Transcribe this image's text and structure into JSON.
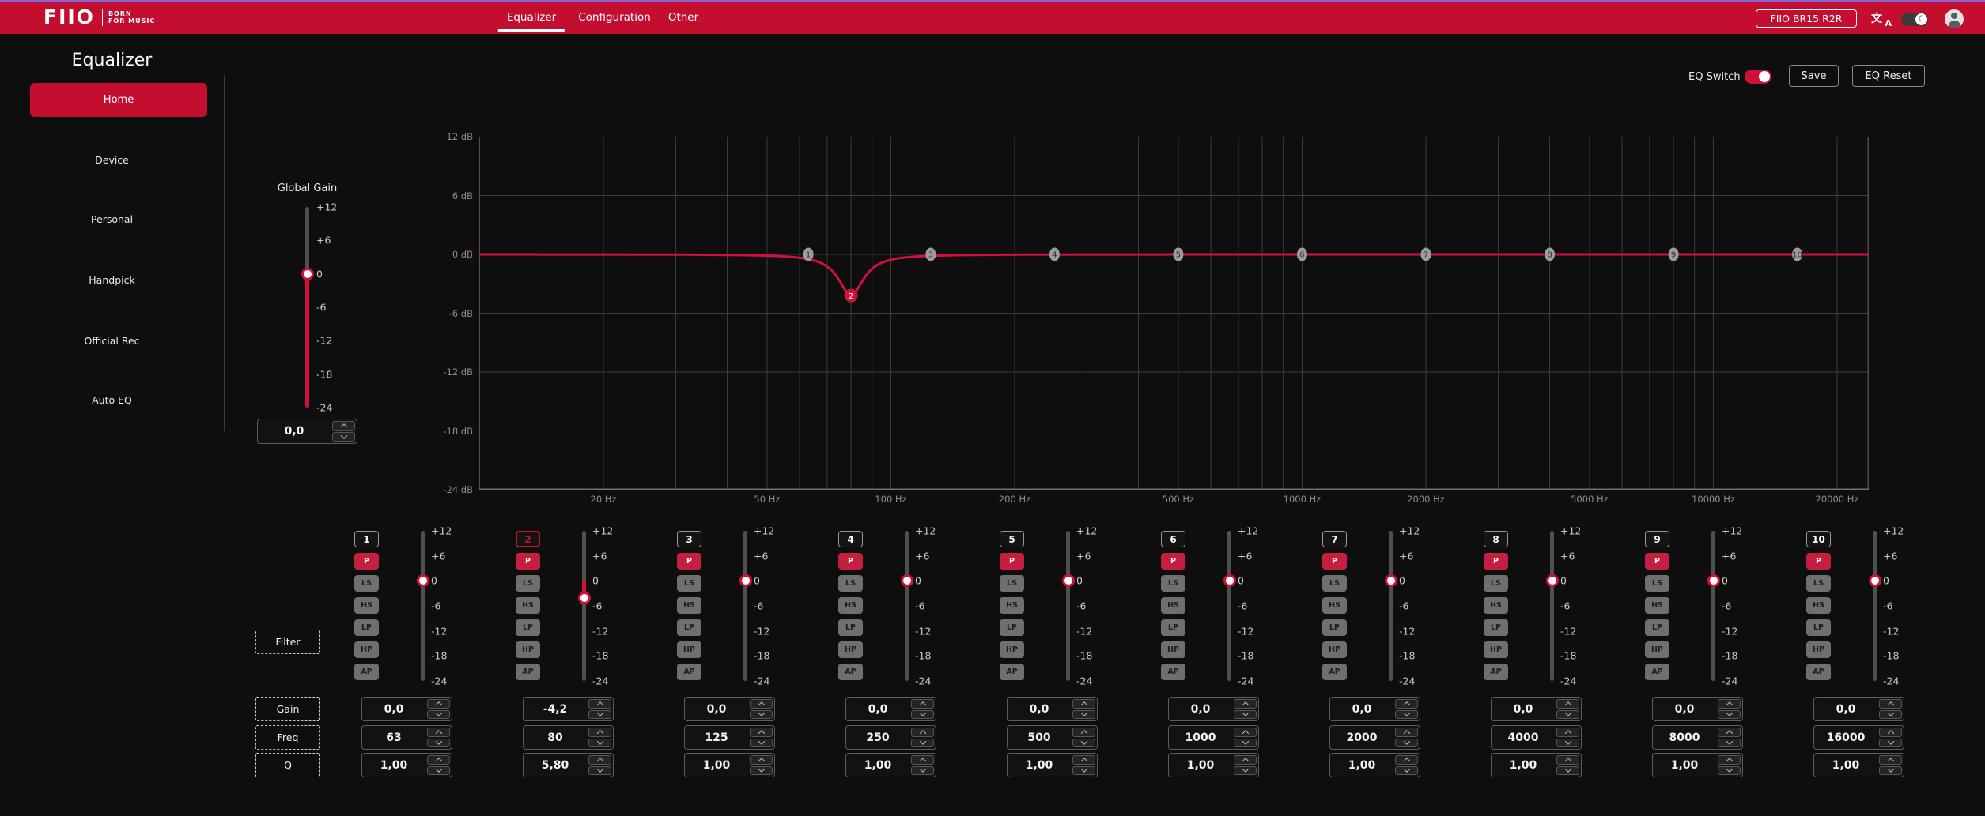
{
  "header": {
    "logo": {
      "brand": "FIIO",
      "tagline1": "BORN",
      "tagline2": "FOR MUSIC"
    },
    "tabs": [
      {
        "label": "Equalizer",
        "active": true
      },
      {
        "label": "Configuration",
        "active": false
      },
      {
        "label": "Other",
        "active": false
      }
    ],
    "device_button": "FIIO BR15 R2R",
    "icons": {
      "translate_zh": "文",
      "translate_a": "A",
      "dark_mode_knob": "☾"
    }
  },
  "sidebar": {
    "title": "Equalizer",
    "items": [
      {
        "label": "Home",
        "active": true
      },
      {
        "label": "Device",
        "active": false
      },
      {
        "label": "Personal",
        "active": false
      },
      {
        "label": "Handpick",
        "active": false
      },
      {
        "label": "Official Rec",
        "active": false
      },
      {
        "label": "Auto EQ",
        "active": false
      }
    ]
  },
  "toolbar": {
    "eq_switch_label": "EQ Switch",
    "eq_switch_on": true,
    "save_label": "Save",
    "reset_label": "EQ Reset"
  },
  "global_gain": {
    "label": "Global Gain",
    "value": "0,0",
    "value_db": 0,
    "scale": [
      "+12",
      "+6",
      "0",
      "-6",
      "-12",
      "-18",
      "-24"
    ]
  },
  "row_labels": {
    "filter": "Filter",
    "gain": "Gain",
    "freq": "Freq",
    "q": "Q"
  },
  "filter_types": [
    "P",
    "LS",
    "HS",
    "LP",
    "HP",
    "AP"
  ],
  "slider_scale": [
    "+12",
    "+6",
    "0",
    "-6",
    "-12",
    "-18",
    "-24"
  ],
  "chart_data": {
    "type": "line",
    "title": "EQ frequency response",
    "x_axis": {
      "scale": "log",
      "unit": "Hz",
      "range_hz": [
        10,
        24000
      ],
      "tick_freqs": [
        20,
        50,
        100,
        200,
        500,
        1000,
        2000,
        5000,
        10000,
        20000
      ],
      "tick_labels": [
        "20 Hz",
        "50 Hz",
        "100 Hz",
        "200 Hz",
        "500 Hz",
        "1000 Hz",
        "2000 Hz",
        "5000 Hz",
        "10000 Hz",
        "20000 Hz"
      ],
      "grid_freqs": [
        10,
        20,
        30,
        40,
        50,
        60,
        70,
        80,
        90,
        100,
        200,
        300,
        400,
        500,
        600,
        700,
        800,
        900,
        1000,
        2000,
        3000,
        4000,
        5000,
        6000,
        7000,
        8000,
        9000,
        10000,
        20000
      ]
    },
    "y_axis": {
      "unit": "dB",
      "range_db": [
        -24,
        12
      ],
      "tick_values": [
        12,
        6,
        0,
        -6,
        -12,
        -18,
        -24
      ],
      "tick_labels": [
        "12 dB",
        "6 dB",
        "0 dB",
        "-6 dB",
        "-12 dB",
        "-18 dB",
        "-24 dB"
      ]
    },
    "grid": true,
    "curve_color": "#d50f3c",
    "curve_description": "flat at 0 dB with a narrow notch of -4.2 dB at 80 Hz (Q 5.8)",
    "bands": [
      {
        "number": "1",
        "filter": "P",
        "freq": 63,
        "gain": 0,
        "q": 1.0,
        "selected": false,
        "gain_text": "0,0",
        "freq_text": "63",
        "q_text": "1,00"
      },
      {
        "number": "2",
        "filter": "P",
        "freq": 80,
        "gain": -4.2,
        "q": 5.8,
        "selected": true,
        "gain_text": "-4,2",
        "freq_text": "80",
        "q_text": "5,80"
      },
      {
        "number": "3",
        "filter": "P",
        "freq": 125,
        "gain": 0,
        "q": 1.0,
        "selected": false,
        "gain_text": "0,0",
        "freq_text": "125",
        "q_text": "1,00"
      },
      {
        "number": "4",
        "filter": "P",
        "freq": 250,
        "gain": 0,
        "q": 1.0,
        "selected": false,
        "gain_text": "0,0",
        "freq_text": "250",
        "q_text": "1,00"
      },
      {
        "number": "5",
        "filter": "P",
        "freq": 500,
        "gain": 0,
        "q": 1.0,
        "selected": false,
        "gain_text": "0,0",
        "freq_text": "500",
        "q_text": "1,00"
      },
      {
        "number": "6",
        "filter": "P",
        "freq": 1000,
        "gain": 0,
        "q": 1.0,
        "selected": false,
        "gain_text": "0,0",
        "freq_text": "1000",
        "q_text": "1,00"
      },
      {
        "number": "7",
        "filter": "P",
        "freq": 2000,
        "gain": 0,
        "q": 1.0,
        "selected": false,
        "gain_text": "0,0",
        "freq_text": "2000",
        "q_text": "1,00"
      },
      {
        "number": "8",
        "filter": "P",
        "freq": 4000,
        "gain": 0,
        "q": 1.0,
        "selected": false,
        "gain_text": "0,0",
        "freq_text": "4000",
        "q_text": "1,00"
      },
      {
        "number": "9",
        "filter": "P",
        "freq": 8000,
        "gain": 0,
        "q": 1.0,
        "selected": false,
        "gain_text": "0,0",
        "freq_text": "8000",
        "q_text": "1,00"
      },
      {
        "number": "10",
        "filter": "P",
        "freq": 16000,
        "gain": 0,
        "q": 1.0,
        "selected": false,
        "gain_text": "0,0",
        "freq_text": "16000",
        "q_text": "1,00"
      }
    ]
  },
  "colors": {
    "topbar_red": "#c30e2f",
    "accent_red": "#c8102e",
    "curve_red": "#d50f3c",
    "background": "#0e0e0e",
    "marker_gray": "#9c9c9c"
  }
}
